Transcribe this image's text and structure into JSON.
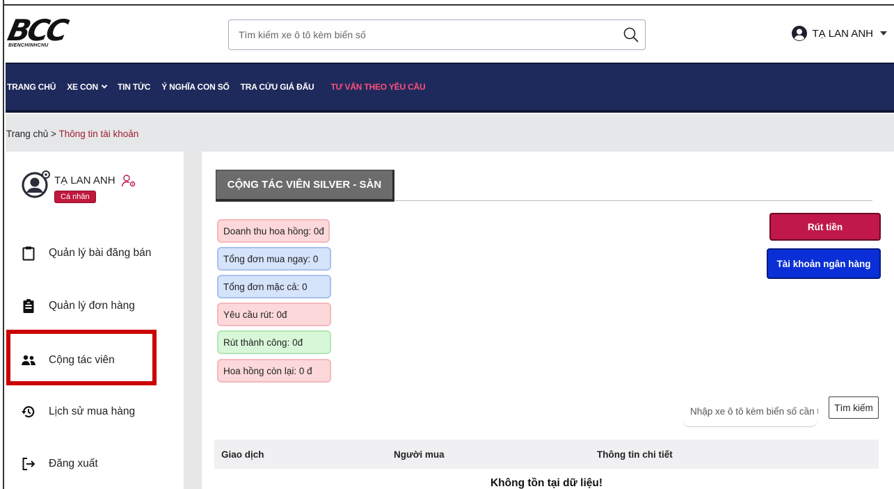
{
  "header": {
    "logo_text": "BCC",
    "logo_subtext": "BIENCHINHCHU",
    "search_placeholder": "Tìm kiếm xe ô tô kèm biển số",
    "user_name": "TẠ LAN ANH"
  },
  "navbar": {
    "items": [
      {
        "label": "TRANG CHỦ"
      },
      {
        "label": "XE CON"
      },
      {
        "label": "TIN TỨC"
      },
      {
        "label": "Ý NGHĨA CON SỐ"
      },
      {
        "label": "TRA CỨU GIÁ ĐẤU"
      },
      {
        "label": "TƯ VẤN THEO YÊU CẦU"
      }
    ]
  },
  "breadcrumb": {
    "home": "Trang chủ",
    "separator": " > ",
    "current": "Thông tin tài khoản"
  },
  "sidebar": {
    "profile_name": "TẠ LAN ANH",
    "profile_badge": "Cá nhân",
    "items": [
      {
        "label": "Quản lý bài đăng bán",
        "icon": "clipboard-icon"
      },
      {
        "label": "Quản lý đơn hàng",
        "icon": "clipboard-list-icon"
      },
      {
        "label": "Cộng tác viên",
        "icon": "users-icon"
      },
      {
        "label": "Lịch sử mua hàng",
        "icon": "history-icon"
      },
      {
        "label": "Đăng xuất",
        "icon": "logout-icon"
      }
    ]
  },
  "main": {
    "title": "CỘNG TÁC VIÊN SILVER - SÀN",
    "stats": [
      {
        "label": "Doanh thu hoa hồng: 0đ",
        "color": "pink"
      },
      {
        "label": "Tổng đơn mua ngay: 0",
        "color": "blue"
      },
      {
        "label": "Tổng đơn mặc cả: 0",
        "color": "blue"
      },
      {
        "label": "Yêu cầu rút: 0đ",
        "color": "pink"
      },
      {
        "label": "Rút thành công: 0đ",
        "color": "green"
      },
      {
        "label": "Hoa hồng còn lại: 0 đ",
        "color": "pink"
      }
    ],
    "withdraw_button": "Rút tiền",
    "bank_button": "Tài khoản ngân hàng",
    "filter_placeholder": "Nhập xe ô tô kèm biển số cần tìm",
    "search_button": "Tìm kiếm",
    "table_headers": [
      "Giao dịch",
      "Người mua",
      "Thông tin chi tiết"
    ],
    "empty_message": "Không tồn tại dữ liệu!"
  },
  "colors": {
    "navbar_bg": "#1f2a5c",
    "nav_highlight": "#ff4f7a",
    "accent_red": "#c0184a",
    "bank_blue": "#0a2fd6",
    "highlight_box": "#cc0000"
  }
}
